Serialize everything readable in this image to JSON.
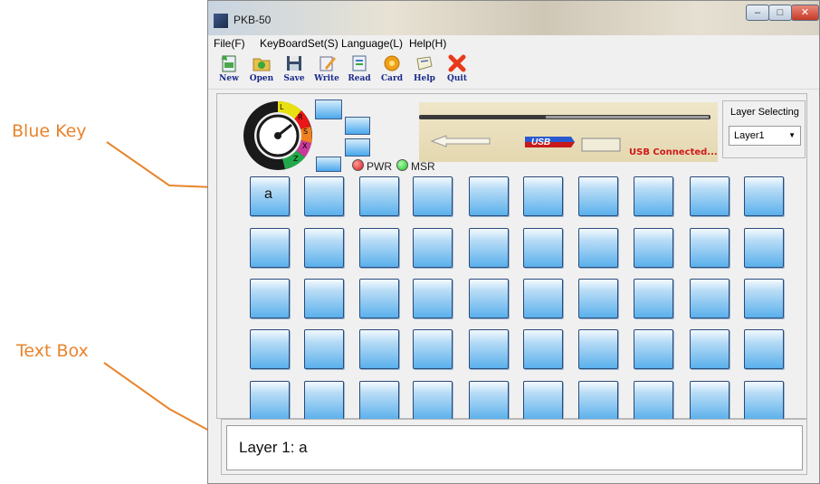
{
  "annotations": {
    "blue_key": "Blue Key",
    "text_box": "Text Box"
  },
  "window": {
    "title": "PKB-50",
    "controls": {
      "minimize": "–",
      "maximize": "□",
      "close": "✕"
    }
  },
  "menu": [
    "File(F)",
    "KeyBoardSet(S)",
    "Language(L)",
    "Help(H)"
  ],
  "toolbar": [
    {
      "label": "New",
      "icon": "new-icon"
    },
    {
      "label": "Open",
      "icon": "open-icon"
    },
    {
      "label": "Save",
      "icon": "save-icon"
    },
    {
      "label": "Write",
      "icon": "write-icon"
    },
    {
      "label": "Read",
      "icon": "read-icon"
    },
    {
      "label": "Card",
      "icon": "card-icon"
    },
    {
      "label": "Help",
      "icon": "help-icon"
    },
    {
      "label": "Quit",
      "icon": "quit-icon"
    }
  ],
  "dial": {
    "letters": [
      "L",
      "R",
      "S",
      "X",
      "Z"
    ]
  },
  "status": {
    "pwr": "PWR",
    "msr": "MSR",
    "pwr_color": "#d81818",
    "msr_color": "#22c222"
  },
  "device": {
    "usb_badge": "USB",
    "usb_status": "USB Connected..."
  },
  "layer": {
    "title": "Layer Selecting",
    "selected": "Layer1"
  },
  "keys": {
    "rows": 5,
    "cols": 10,
    "labels": [
      "a"
    ]
  },
  "text_box": {
    "value": "Layer 1: a"
  },
  "colors": {
    "annotation": "#e8842c",
    "key_blue": "#5ab0ec",
    "toolbar_label": "#1a2a8a"
  }
}
